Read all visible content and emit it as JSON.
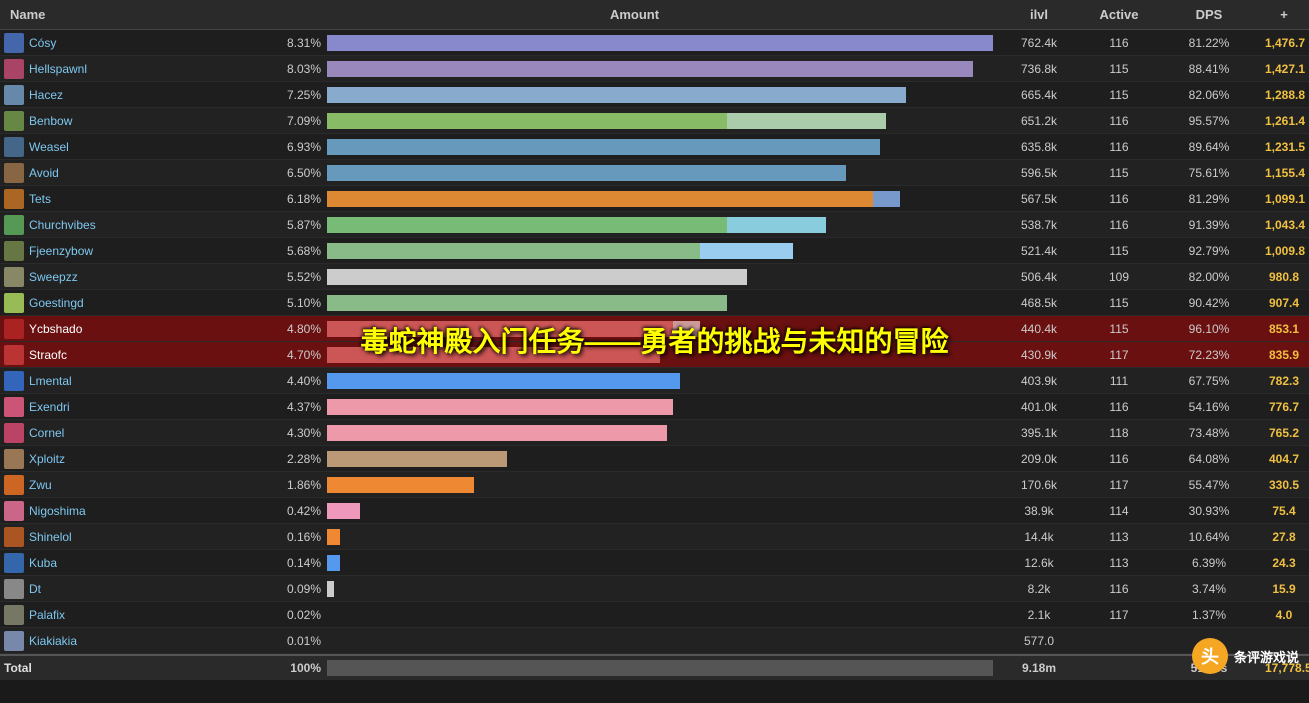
{
  "header": {
    "col_name": "Name",
    "col_amount": "Amount",
    "col_ilvl": "ilvl",
    "col_active": "Active",
    "col_dps": "DPS",
    "col_plus": "+"
  },
  "overlay": {
    "text": "毒蛇神殿入门任务——勇者的挑战与未知的冒险"
  },
  "watermark": {
    "logo": "头",
    "text": "条评游戏说"
  },
  "rows": [
    {
      "name": "Cósy",
      "pct": "8.31%",
      "value": "762.4k",
      "ilvl": "116",
      "active": "81.22%",
      "dps": "1,476.7",
      "color1": "#8888cc",
      "w1": 1.0,
      "color2": null,
      "w2": 0,
      "highlighted": false,
      "avatarColor": "#4466aa"
    },
    {
      "name": "Hellspawnl",
      "pct": "8.03%",
      "value": "736.8k",
      "ilvl": "115",
      "active": "88.41%",
      "dps": "1,427.1",
      "color1": "#9988bb",
      "w1": 0.965,
      "color2": null,
      "w2": 0,
      "highlighted": false,
      "avatarColor": "#aa4466"
    },
    {
      "name": "Hacez",
      "pct": "7.25%",
      "value": "665.4k",
      "ilvl": "115",
      "active": "82.06%",
      "dps": "1,288.8",
      "color1": "#88aacc",
      "w1": 0.87,
      "color2": null,
      "w2": 0,
      "highlighted": false,
      "avatarColor": "#6688aa"
    },
    {
      "name": "Benbow",
      "pct": "7.09%",
      "value": "651.2k",
      "ilvl": "116",
      "active": "95.57%",
      "dps": "1,261.4",
      "color1": "#88bb66",
      "w1": 0.6,
      "color2": "#aaccaa",
      "w2": 0.24,
      "highlighted": false,
      "avatarColor": "#668844"
    },
    {
      "name": "Weasel",
      "pct": "6.93%",
      "value": "635.8k",
      "ilvl": "116",
      "active": "89.64%",
      "dps": "1,231.5",
      "color1": "#6699bb",
      "w1": 0.83,
      "color2": null,
      "w2": 0,
      "highlighted": false,
      "avatarColor": "#446688"
    },
    {
      "name": "Avoid",
      "pct": "6.50%",
      "value": "596.5k",
      "ilvl": "115",
      "active": "75.61%",
      "dps": "1,155.4",
      "color1": "#6699bb",
      "w1": 0.78,
      "color2": null,
      "w2": 0,
      "highlighted": false,
      "avatarColor": "#886644"
    },
    {
      "name": "Tets",
      "pct": "6.18%",
      "value": "567.5k",
      "ilvl": "116",
      "active": "81.29%",
      "dps": "1,099.1",
      "color1": "#dd8833",
      "w1": 0.82,
      "color2": "#7799cc",
      "w2": 0.04,
      "highlighted": false,
      "avatarColor": "#aa6622"
    },
    {
      "name": "Churchvibes",
      "pct": "5.87%",
      "value": "538.7k",
      "ilvl": "116",
      "active": "91.39%",
      "dps": "1,043.4",
      "color1": "#77bb77",
      "w1": 0.6,
      "color2": "#88ccdd",
      "w2": 0.15,
      "highlighted": false,
      "avatarColor": "#559955"
    },
    {
      "name": "Fjeenzybow",
      "pct": "5.68%",
      "value": "521.4k",
      "ilvl": "115",
      "active": "92.79%",
      "dps": "1,009.8",
      "color1": "#88bb88",
      "w1": 0.56,
      "color2": "#99ccee",
      "w2": 0.14,
      "highlighted": false,
      "avatarColor": "#667744"
    },
    {
      "name": "Sweepzz",
      "pct": "5.52%",
      "value": "506.4k",
      "ilvl": "109",
      "active": "82.00%",
      "dps": "980.8",
      "color1": "#cccccc",
      "w1": 0.63,
      "color2": null,
      "w2": 0,
      "highlighted": false,
      "avatarColor": "#888866"
    },
    {
      "name": "Goestingd",
      "pct": "5.10%",
      "value": "468.5k",
      "ilvl": "115",
      "active": "90.42%",
      "dps": "907.4",
      "color1": "#88bb88",
      "w1": 0.6,
      "color2": null,
      "w2": 0,
      "highlighted": false,
      "avatarColor": "#99bb55"
    },
    {
      "name": "Ycbshado",
      "pct": "4.80%",
      "value": "440.4k",
      "ilvl": "115",
      "active": "96.10%",
      "dps": "853.1",
      "color1": "#cc5555",
      "w1": 0.52,
      "color2": "#cc9999",
      "w2": 0.04,
      "highlighted": true,
      "avatarColor": "#aa2222"
    },
    {
      "name": "Straofc",
      "pct": "4.70%",
      "value": "430.9k",
      "ilvl": "117",
      "active": "72.23%",
      "dps": "835.9",
      "color1": "#cc5555",
      "w1": 0.5,
      "color2": null,
      "w2": 0,
      "highlighted": true,
      "avatarColor": "#bb3333"
    },
    {
      "name": "Lmental",
      "pct": "4.40%",
      "value": "403.9k",
      "ilvl": "111",
      "active": "67.75%",
      "dps": "782.3",
      "color1": "#5599ee",
      "w1": 0.53,
      "color2": null,
      "w2": 0,
      "highlighted": false,
      "avatarColor": "#3366bb"
    },
    {
      "name": "Exendri",
      "pct": "4.37%",
      "value": "401.0k",
      "ilvl": "116",
      "active": "54.16%",
      "dps": "776.7",
      "color1": "#ee99aa",
      "w1": 0.52,
      "color2": null,
      "w2": 0,
      "highlighted": false,
      "avatarColor": "#cc5577"
    },
    {
      "name": "Cornel",
      "pct": "4.30%",
      "value": "395.1k",
      "ilvl": "118",
      "active": "73.48%",
      "dps": "765.2",
      "color1": "#ee99aa",
      "w1": 0.51,
      "color2": null,
      "w2": 0,
      "highlighted": false,
      "avatarColor": "#bb4466"
    },
    {
      "name": "Xploitz",
      "pct": "2.28%",
      "value": "209.0k",
      "ilvl": "116",
      "active": "64.08%",
      "dps": "404.7",
      "color1": "#bb9977",
      "w1": 0.27,
      "color2": null,
      "w2": 0,
      "highlighted": false,
      "avatarColor": "#997755"
    },
    {
      "name": "Zwu",
      "pct": "1.86%",
      "value": "170.6k",
      "ilvl": "117",
      "active": "55.47%",
      "dps": "330.5",
      "color1": "#ee8833",
      "w1": 0.22,
      "color2": null,
      "w2": 0,
      "highlighted": false,
      "avatarColor": "#cc6622"
    },
    {
      "name": "Nigoshima",
      "pct": "0.42%",
      "value": "38.9k",
      "ilvl": "114",
      "active": "30.93%",
      "dps": "75.4",
      "color1": "#ee99bb",
      "w1": 0.05,
      "color2": null,
      "w2": 0,
      "highlighted": false,
      "avatarColor": "#cc6688"
    },
    {
      "name": "Shinelol",
      "pct": "0.16%",
      "value": "14.4k",
      "ilvl": "113",
      "active": "10.64%",
      "dps": "27.8",
      "color1": "#ee8833",
      "w1": 0.02,
      "color2": null,
      "w2": 0,
      "highlighted": false,
      "avatarColor": "#aa5522"
    },
    {
      "name": "Kuba",
      "pct": "0.14%",
      "value": "12.6k",
      "ilvl": "113",
      "active": "6.39%",
      "dps": "24.3",
      "color1": "#5599ee",
      "w1": 0.015,
      "color2": null,
      "w2": 0,
      "highlighted": false,
      "avatarColor": "#3366aa"
    },
    {
      "name": "Dt",
      "pct": "0.09%",
      "value": "8.2k",
      "ilvl": "116",
      "active": "3.74%",
      "dps": "15.9",
      "color1": "#cccccc",
      "w1": 0.01,
      "color2": null,
      "w2": 0,
      "highlighted": false,
      "avatarColor": "#888888"
    },
    {
      "name": "Palafix",
      "pct": "0.02%",
      "value": "2.1k",
      "ilvl": "117",
      "active": "1.37%",
      "dps": "4.0",
      "color1": "#cccccc",
      "w1": 0.003,
      "color2": null,
      "w2": 0,
      "highlighted": false,
      "avatarColor": "#777766"
    },
    {
      "name": "Kiakiakia",
      "pct": "0.01%",
      "value": "577.0",
      "ilvl": "",
      "active": "",
      "dps": "",
      "color1": "#cccccc",
      "w1": 0.002,
      "color2": null,
      "w2": 0,
      "highlighted": false,
      "avatarColor": "#7788aa"
    }
  ],
  "total": {
    "label": "Total",
    "pct": "100%",
    "value": "9.18m",
    "ilvl": "",
    "active": "516.3s",
    "dps": "17,778.5",
    "plus": "+"
  },
  "avatarColors": {
    "note": "inline styles used per row"
  }
}
